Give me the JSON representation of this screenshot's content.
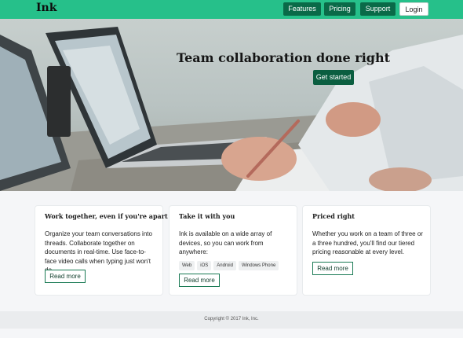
{
  "nav": {
    "brand": "Ink",
    "items": [
      {
        "label": "Features"
      },
      {
        "label": "Pricing"
      },
      {
        "label": "Support"
      },
      {
        "label": "Login"
      }
    ]
  },
  "hero": {
    "title": "Team collaboration done right",
    "cta_label": "Get started"
  },
  "cards": [
    {
      "title": "Work together, even if you're apart",
      "text": "Organize your team conversations into threads. Collaborate together on documents in real-time. Use face-to-face video calls when typing just won't do.",
      "button_label": "Read more"
    },
    {
      "title": "Take it with you",
      "text": "Ink is available on a wide array of devices, so you can work from anywhere:",
      "tags": [
        "Web",
        "iOS",
        "Android",
        "Windows Phone"
      ],
      "button_label": "Read more"
    },
    {
      "title": "Priced right",
      "text": "Whether you work on a team of three or a three hundred, you'll find our tiered pricing reasonable at every level.",
      "button_label": "Read more"
    }
  ],
  "footer": {
    "copyright": "Copyright © 2017 Ink, Inc."
  }
}
